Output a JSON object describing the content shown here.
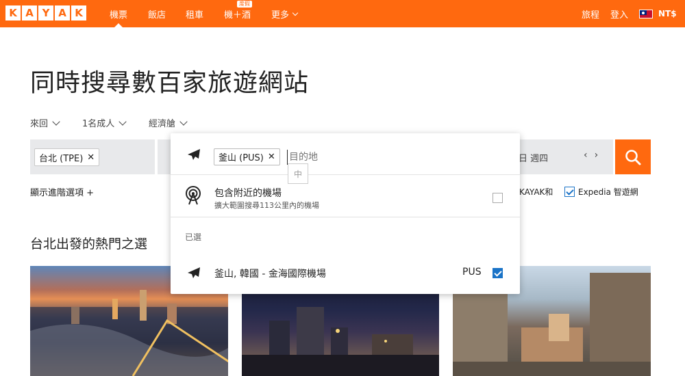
{
  "nav": {
    "logo_letters": [
      "K",
      "A",
      "Y",
      "A",
      "K"
    ],
    "items": [
      {
        "label": "機票",
        "active": true
      },
      {
        "label": "飯店"
      },
      {
        "label": "租車"
      },
      {
        "label": "機＋酒",
        "badge": "度假"
      },
      {
        "label": "更多"
      }
    ],
    "right": {
      "trips": "旅程",
      "login": "登入",
      "currency": "NT$"
    }
  },
  "hero": {
    "title": "同時搜尋數百家旅遊網站"
  },
  "options": {
    "trip_type": "來回",
    "travelers": "1名成人",
    "cabin": "經濟艙"
  },
  "search": {
    "origin_chip": "台北 (TPE)",
    "date_text": "日 週四",
    "prev": "‹",
    "next": "›",
    "advanced": "顯示進階選項 +"
  },
  "compare": {
    "kayak_text": "KAYAK和",
    "expedia_text": "Expedia 智遊網"
  },
  "dropdown": {
    "chip": "釜山 (PUS)",
    "placeholder": "目的地",
    "ime": "中",
    "nearby_title": "包含附近的機場",
    "nearby_sub": "擴大範圍搜尋113公里內的機場",
    "selected_label": "已選",
    "selected_airport": "釜山, 韓國 - 金海國際機場",
    "selected_code": "PUS"
  },
  "popular": {
    "title": "台北出發的熱門之選"
  },
  "colors": {
    "brand": "#ff690f",
    "checkbox": "#1a73c7"
  }
}
